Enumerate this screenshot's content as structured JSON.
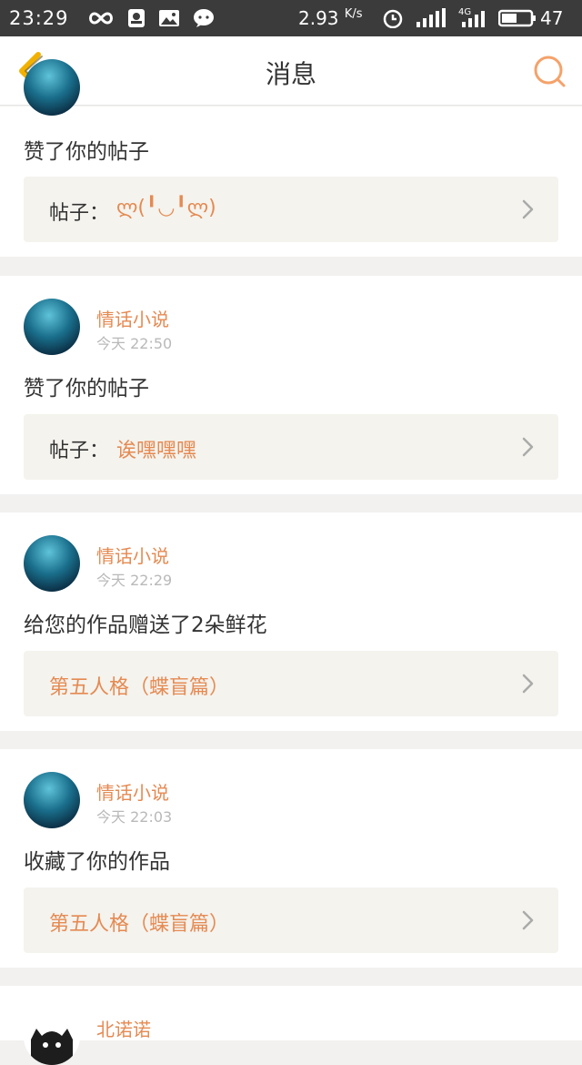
{
  "status_bar": {
    "time": "23:29",
    "speed": "2.93",
    "speed_unit": "K/s",
    "network_badge": "4G",
    "battery": "47"
  },
  "header": {
    "title": "消息"
  },
  "colors": {
    "accent": "#e58a52",
    "back_arrow": "#f2b100",
    "link_bg": "#f4f3ee"
  },
  "notifications": [
    {
      "action": "赞了你的帖子",
      "prefix": "帖子：",
      "title": "ლ(╹◡╹ლ)"
    },
    {
      "user": "情话小说",
      "time": "今天 22:50",
      "action": "赞了你的帖子",
      "prefix": "帖子：",
      "title": "诶嘿嘿嘿"
    },
    {
      "user": "情话小说",
      "time": "今天 22:29",
      "action": "给您的作品赠送了2朵鲜花",
      "title": "第五人格（蝶盲篇）"
    },
    {
      "user": "情话小说",
      "time": "今天 22:03",
      "action": "收藏了你的作品",
      "title": "第五人格（蝶盲篇）"
    },
    {
      "user": "北诺诺"
    }
  ]
}
